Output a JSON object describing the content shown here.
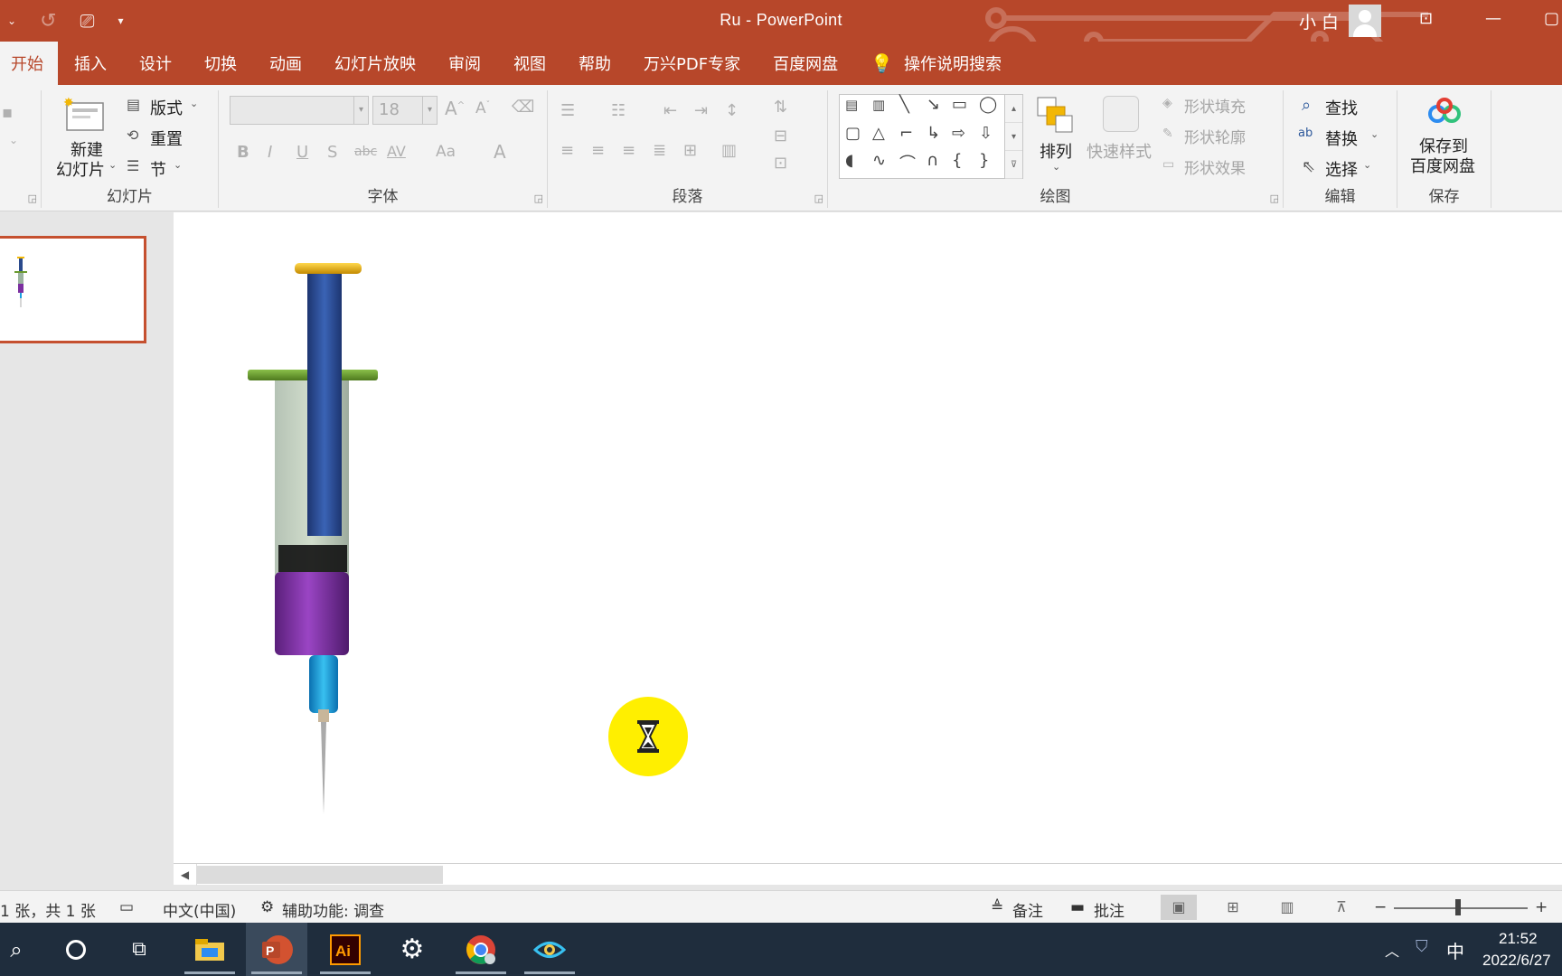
{
  "window": {
    "title": "Ru  -  PowerPoint",
    "user_name": "小 白"
  },
  "tabs": [
    {
      "label": "开始",
      "active": true
    },
    {
      "label": "插入"
    },
    {
      "label": "设计"
    },
    {
      "label": "切换"
    },
    {
      "label": "动画"
    },
    {
      "label": "幻灯片放映"
    },
    {
      "label": "审阅"
    },
    {
      "label": "视图"
    },
    {
      "label": "帮助"
    },
    {
      "label": "万兴PDF专家"
    },
    {
      "label": "百度网盘"
    },
    {
      "label": "操作说明搜索"
    }
  ],
  "ribbon": {
    "slides": {
      "new_slide_line1": "新建",
      "new_slide_line2": "幻灯片",
      "layout": "版式",
      "reset": "重置",
      "section": "节",
      "group_label": "幻灯片"
    },
    "font": {
      "font_name": "",
      "font_size": "18",
      "group_label": "字体",
      "bold": "B",
      "italic": "I",
      "underline": "U",
      "shadow": "S",
      "strike": "abc",
      "spacing": "AV",
      "case": "Aa",
      "color": "A"
    },
    "paragraph": {
      "group_label": "段落"
    },
    "drawing": {
      "arrange": "排列",
      "quick_styles": "快速样式",
      "shape_fill": "形状填充",
      "shape_outline": "形状轮廓",
      "shape_effects": "形状效果",
      "group_label": "绘图"
    },
    "editing": {
      "find": "查找",
      "replace": "替换",
      "select": "选择",
      "group_label": "编辑"
    },
    "save": {
      "line1": "保存到",
      "line2": "百度网盘",
      "group_label": "保存"
    }
  },
  "statusbar": {
    "slide_count": "1 张，共 1 张",
    "language": "中文(中国)",
    "accessibility": "辅助功能: 调查",
    "notes": "备注",
    "comments": "批注",
    "zoom_minus": "−",
    "zoom_plus": "+"
  },
  "taskbar": {
    "ime": "中",
    "time": "21:52",
    "date": "2022/6/27"
  },
  "colors": {
    "accent": "#b7472a",
    "plunger_cap": "#f2b705",
    "flange": "#6a9a2e",
    "rod": "#2a4a8c",
    "liquid": "#7b2fa0",
    "hub": "#1aa0e0",
    "cursor_highlight": "#ffef00"
  }
}
